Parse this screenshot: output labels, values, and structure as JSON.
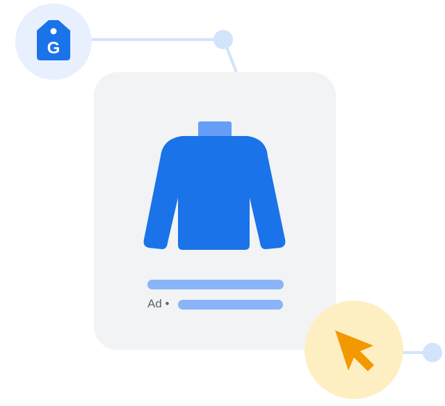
{
  "card": {
    "ad_label": "Ad •"
  },
  "icons": {
    "tag": "google-tag-icon",
    "tag_letter": "G",
    "product": "sweater-icon",
    "cursor": "mouse-cursor-icon"
  },
  "colors": {
    "primary_blue": "#1a73e8",
    "light_blue": "#8ab4f8",
    "pale_blue": "#e8f0fe",
    "node_blue": "#d2e3fc",
    "card_gray": "#f1f3f4",
    "cursor_orange": "#f29900",
    "cursor_bg": "#feefc3"
  }
}
